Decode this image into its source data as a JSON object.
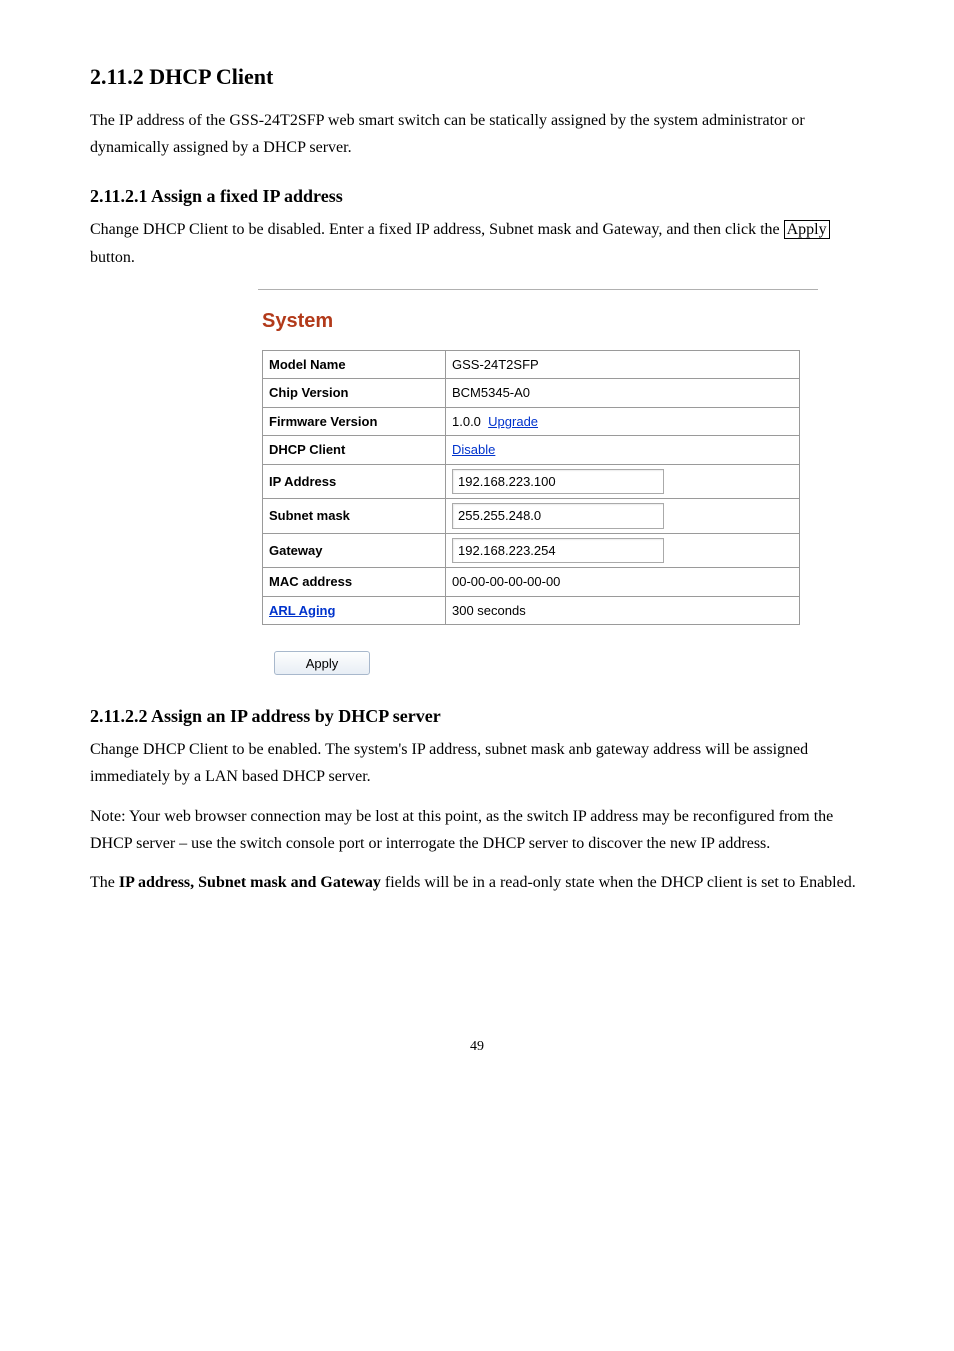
{
  "headings": {
    "h2": "2.11.2  DHCP Client",
    "h3a": "2.11.2.1  Assign a fixed IP address",
    "h3b": "2.11.2.2  Assign an IP address by DHCP server"
  },
  "paras": {
    "p1": "The IP address of the GSS-24T2SFP web smart switch can be statically assigned by the system administrator or dynamically assigned by a DHCP server.",
    "p2a": "Change DHCP Client to be disabled. Enter a fixed IP address, Subnet mask and Gateway, and then click the ",
    "p2b": "Apply",
    "p2c": " button.",
    "p3": "Change DHCP Client to be enabled. The system's IP address, subnet mask anb gateway address will be assigned immediately by a LAN based DHCP server.",
    "p4": "Note: Your web browser connection may be lost at this point, as the switch IP address may be reconfigured from the DHCP server – use the switch console port or interrogate the DHCP server to discover the new IP address.",
    "p5a": "The ",
    "p5b": "IP address, Subnet mask and Gateway",
    "p5c": " fields will be in a read-only state when the DHCP client is set to Enabled."
  },
  "panel": {
    "title": "System",
    "rows": {
      "model_k": "Model Name",
      "model_v": "GSS-24T2SFP",
      "chip_k": "Chip Version",
      "chip_v": "BCM5345-A0",
      "fw_k": "Firmware Version",
      "fw_v1": "1.0.0",
      "fw_link": "Upgrade",
      "dhcp_k": "DHCP Client",
      "dhcp_link": "Disable",
      "ip_k": "IP Address",
      "ip_v": "192.168.223.100",
      "sm_k": "Subnet mask",
      "sm_v": "255.255.248.0",
      "gw_k": "Gateway",
      "gw_v": "192.168.223.254",
      "mac_k": "MAC address",
      "mac_v": "00-00-00-00-00-00",
      "arl_k": "ARL Aging",
      "arl_v": "300 seconds"
    },
    "apply_btn": "Apply"
  },
  "pagenum": "49"
}
